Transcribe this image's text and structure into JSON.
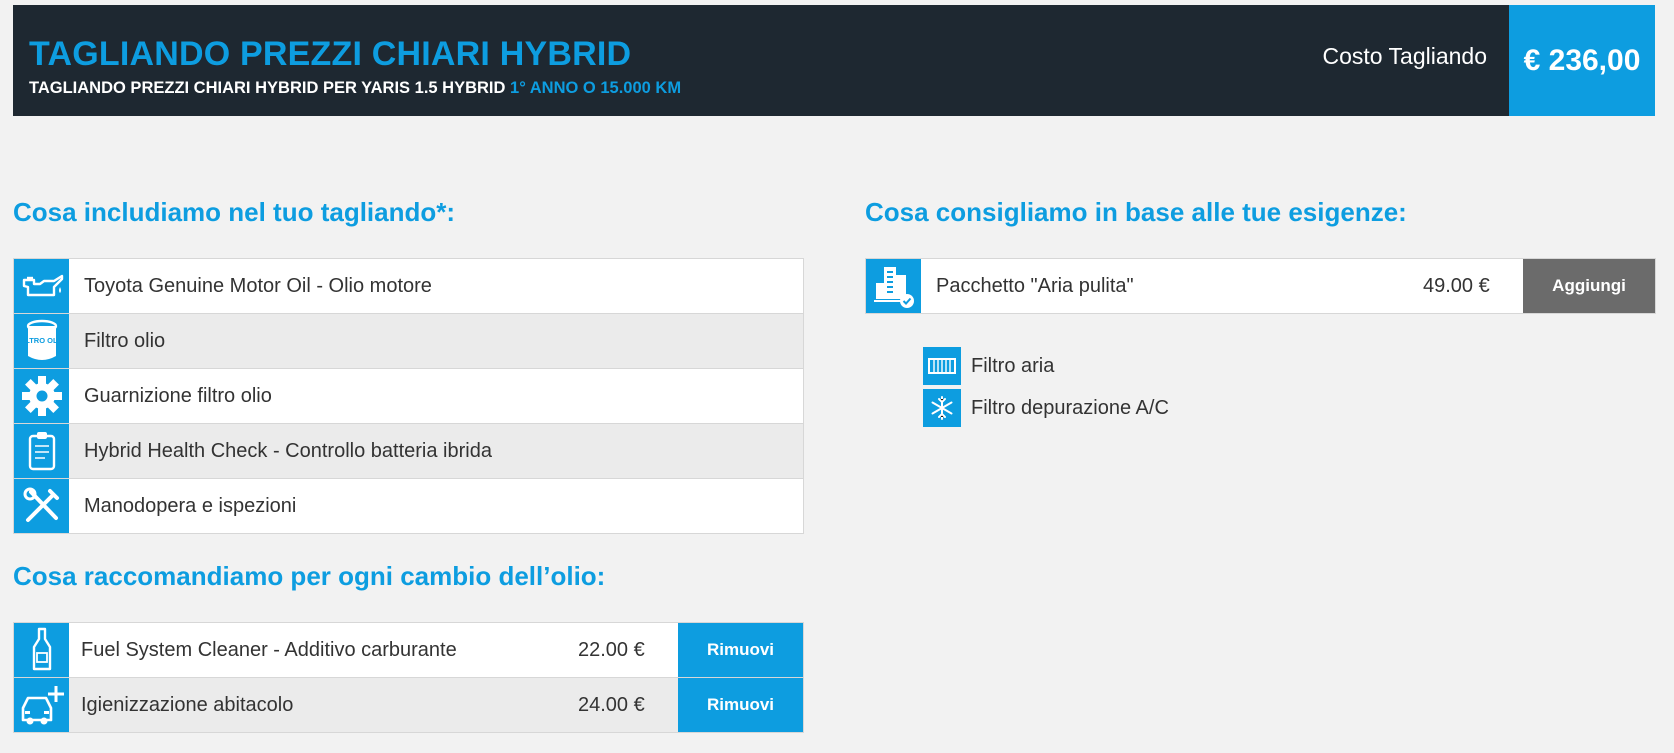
{
  "header": {
    "title": "TAGLIANDO PREZZI CHIARI HYBRID",
    "subtitle_main": "TAGLIANDO PREZZI CHIARI HYBRID PER YARIS 1.5 HYBRID",
    "subtitle_highlight": "1° ANNO O 15.000 KM",
    "cost_label": "Costo Tagliando",
    "cost_value": "€ 236,00"
  },
  "colors": {
    "accent": "#0d9de0",
    "header_bg": "#1e2831",
    "button_gray": "#6b6b6b"
  },
  "included": {
    "title": "Cosa includiamo nel tuo tagliando*:",
    "items": [
      {
        "icon": "oil-can-icon",
        "label": "Toyota Genuine Motor Oil - Olio motore"
      },
      {
        "icon": "oil-filter-icon",
        "label": "Filtro olio",
        "icon_text": "FILTRO OLIO"
      },
      {
        "icon": "gear-icon",
        "label": "Guarnizione filtro olio"
      },
      {
        "icon": "clipboard-icon",
        "label": "Hybrid Health Check - Controllo batteria ibrida"
      },
      {
        "icon": "tools-icon",
        "label": "Manodopera e ispezioni"
      }
    ]
  },
  "oil_change": {
    "title": "Cosa raccomandiamo per ogni cambio dell’olio:",
    "items": [
      {
        "icon": "bottle-icon",
        "label": "Fuel System Cleaner - Additivo carburante",
        "price": "22.00 €",
        "button": "Rimuovi"
      },
      {
        "icon": "car-plus-icon",
        "label": "Igienizzazione abitacolo",
        "price": "24.00 €",
        "button": "Rimuovi"
      }
    ]
  },
  "recommended": {
    "title": "Cosa consigliamo in base alle tue esigenze:",
    "package": {
      "icon": "city-air-icon",
      "label": "Pacchetto \"Aria pulita\"",
      "price": "49.00 €",
      "button": "Aggiungi"
    },
    "sub_items": [
      {
        "icon": "air-filter-icon",
        "label": "Filtro aria"
      },
      {
        "icon": "snowflake-icon",
        "label": "Filtro depurazione A/C"
      }
    ]
  }
}
